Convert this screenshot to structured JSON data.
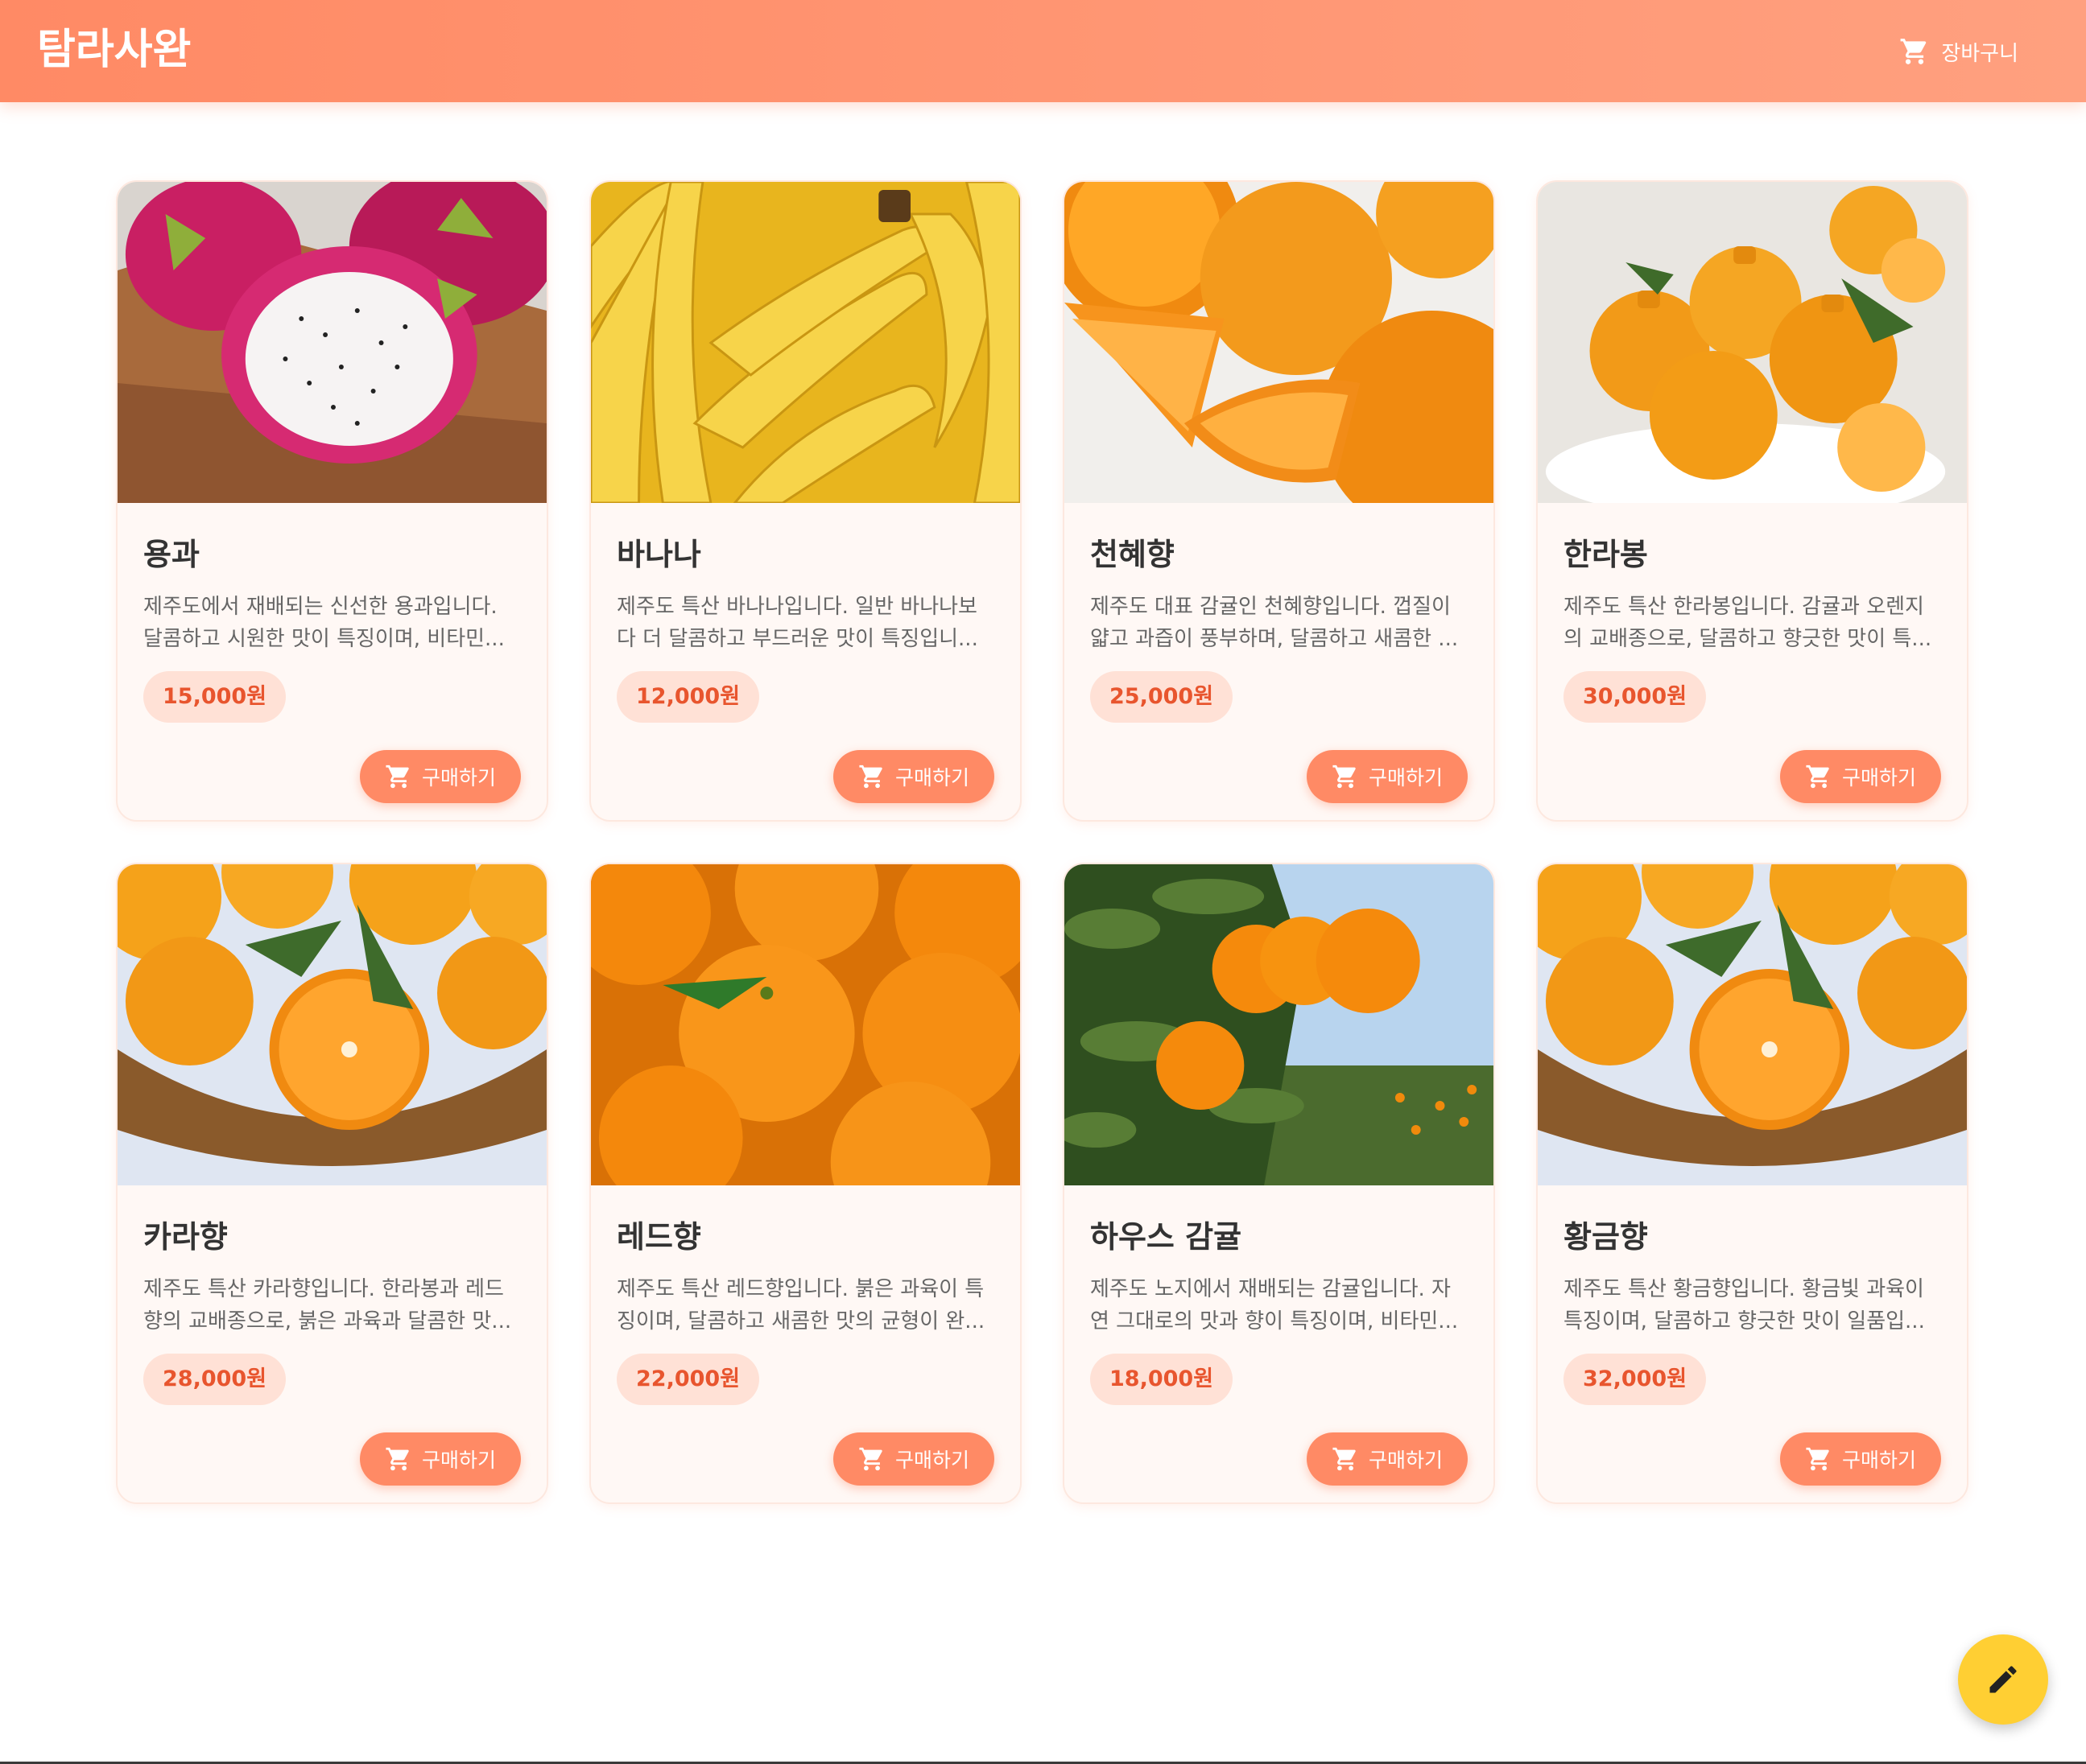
{
  "header": {
    "brand": "탐라사완",
    "cart_label": "장바구니",
    "cart_icon": "cart-icon"
  },
  "colors": {
    "appbar": "#ff8a65",
    "price_text": "#e8552e",
    "price_chip": "#ffe1d6",
    "buy_button": "#ff8a65",
    "fab": "#ffcf33"
  },
  "products": [
    {
      "name": "용과",
      "description": "제주도에서 재배되는 신선한 용과입니다. 달콤하고 시원한 맛이 특징이며, 비타민...",
      "price": "15,000원",
      "buy_label": "구매하기",
      "image": "dragon-fruit"
    },
    {
      "name": "바나나",
      "description": "제주도 특산 바나나입니다. 일반 바나나보다 더 달콤하고 부드러운 맛이 특징입니...",
      "price": "12,000원",
      "buy_label": "구매하기",
      "image": "bananas"
    },
    {
      "name": "천혜향",
      "description": "제주도 대표 감귤인 천혜향입니다. 껍질이 얇고 과즙이 풍부하며, 달콤하고 새콤한 ...",
      "price": "25,000원",
      "buy_label": "구매하기",
      "image": "oranges-sliced"
    },
    {
      "name": "한라봉",
      "description": "제주도 특산 한라봉입니다. 감귤과 오렌지의 교배종으로, 달콤하고 향긋한 맛이 특...",
      "price": "30,000원",
      "buy_label": "구매하기",
      "image": "hallabong"
    },
    {
      "name": "카라향",
      "description": "제주도 특산 카라향입니다. 한라봉과 레드향의 교배종으로, 붉은 과육과 달콤한 맛...",
      "price": "28,000원",
      "buy_label": "구매하기",
      "image": "tangerine-basket"
    },
    {
      "name": "레드향",
      "description": "제주도 특산 레드향입니다. 붉은 과육이 특징이며, 달콤하고 새콤한 맛의 균형이 완...",
      "price": "22,000원",
      "buy_label": "구매하기",
      "image": "mandarins"
    },
    {
      "name": "하우스 감귤",
      "description": "제주도 노지에서 재배되는 감귤입니다. 자연 그대로의 맛과 향이 특징이며, 비타민...",
      "price": "18,000원",
      "buy_label": "구매하기",
      "image": "tangerine-tree"
    },
    {
      "name": "황금향",
      "description": "제주도 특산 황금향입니다. 황금빛 과육이 특징이며, 달콤하고 향긋한 맛이 일품입...",
      "price": "32,000원",
      "buy_label": "구매하기",
      "image": "tangerine-basket"
    }
  ],
  "fab": {
    "icon": "pencil-icon"
  }
}
